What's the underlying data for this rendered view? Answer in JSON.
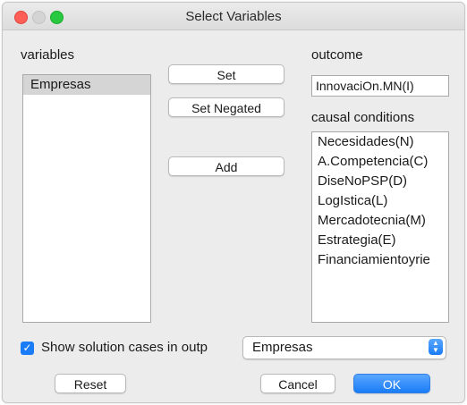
{
  "window": {
    "title": "Select Variables"
  },
  "variables": {
    "label": "variables",
    "items": [
      "Empresas"
    ]
  },
  "buttons": {
    "set": "Set",
    "set_negated": "Set Negated",
    "add": "Add",
    "reset": "Reset",
    "cancel": "Cancel",
    "ok": "OK"
  },
  "outcome": {
    "label": "outcome",
    "value": "InnovaciOn.MN(I)"
  },
  "causal_conditions": {
    "label": "causal conditions",
    "items": [
      "Necesidades(N)",
      "A.Competencia(C)",
      "DiseNoPSP(D)",
      "LogIstica(L)",
      "Mercadotecnia(M)",
      "Estrategia(E)",
      "Financiamientoyrie"
    ]
  },
  "show_cases": {
    "label": "Show solution cases in outp",
    "checked": true,
    "selected": "Empresas"
  },
  "colors": {
    "accent": "#1a7cf6",
    "close": "#fe5f57",
    "zoom": "#28c840"
  }
}
